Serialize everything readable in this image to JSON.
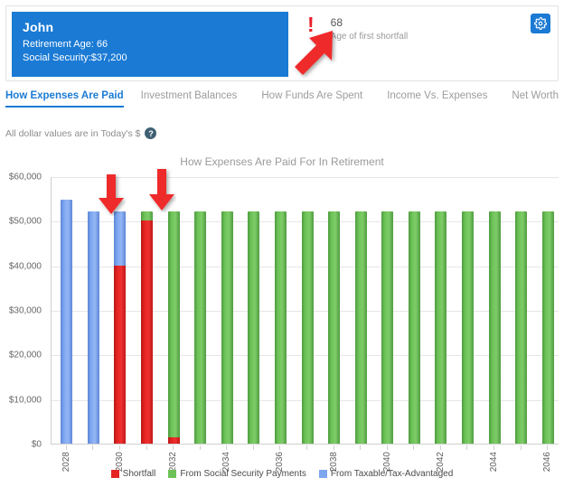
{
  "header": {
    "person": {
      "name": "John",
      "retirement_age_line": "Retirement Age: 66",
      "social_security_line": "Social Security:$37,200"
    },
    "metric": {
      "icon": "exclamation-icon",
      "value": "68",
      "label": "Age of first shortfall"
    },
    "settings_icon": "gear-icon"
  },
  "tabs": [
    {
      "label": "How Expenses Are Paid",
      "active": true
    },
    {
      "label": "Investment Balances",
      "active": false
    },
    {
      "label": "How Funds Are Spent",
      "active": false
    },
    {
      "label": "Income Vs. Expenses",
      "active": false
    },
    {
      "label": "Net Worth",
      "active": false
    }
  ],
  "subnote": {
    "text": "All dollar values are in Today's $",
    "help_icon": "question-mark-icon",
    "help_glyph": "?"
  },
  "colors": {
    "brand_blue": "#1a7ad4",
    "shortfall_red": "#e52222",
    "social_green": "#6cc257",
    "taxable_blue": "#7ea6ef",
    "annotation_red": "#ef2b2b"
  },
  "chart_data": {
    "type": "bar",
    "title": "How Expenses Are Paid For In Retirement",
    "xlabel": "",
    "ylabel": "",
    "ylim": [
      0,
      60000
    ],
    "ytick_labels": [
      "$0",
      "$10,000",
      "$20,000",
      "$30,000",
      "$40,000",
      "$50,000",
      "$60,000"
    ],
    "ytick_values": [
      0,
      10000,
      20000,
      30000,
      40000,
      50000,
      60000
    ],
    "grid": true,
    "stacked": true,
    "legend_position": "bottom",
    "categories": [
      "2028",
      "2029",
      "2030",
      "2031",
      "2032",
      "2033",
      "2034",
      "2035",
      "2036",
      "2037",
      "2038",
      "2039",
      "2040",
      "2041",
      "2042",
      "2043",
      "2044",
      "2045",
      "2046"
    ],
    "xtick_labels": [
      "2028",
      "2030",
      "2032",
      "2034",
      "2036",
      "2038",
      "2040",
      "2042",
      "2044",
      "2046"
    ],
    "series": [
      {
        "name": "Shortfall",
        "color": "#e52222",
        "values": [
          0,
          0,
          40000,
          50000,
          1500,
          0,
          0,
          0,
          0,
          0,
          0,
          0,
          0,
          0,
          0,
          0,
          0,
          0,
          0
        ]
      },
      {
        "name": "From Social Security Payments",
        "color": "#6cc257",
        "values": [
          0,
          0,
          0,
          2200,
          50500,
          52000,
          52000,
          52000,
          52000,
          52000,
          52000,
          52000,
          52000,
          52000,
          52000,
          52000,
          52000,
          52000,
          52000
        ]
      },
      {
        "name": "From Taxable/Tax-Advantaged",
        "color": "#7ea6ef",
        "values": [
          54700,
          52000,
          12000,
          0,
          0,
          0,
          0,
          0,
          0,
          0,
          0,
          0,
          0,
          0,
          0,
          0,
          0,
          0,
          0
        ]
      }
    ],
    "totals": [
      54700,
      52000,
      52000,
      52200,
      52000,
      52000,
      52000,
      52000,
      52000,
      52000,
      52000,
      52000,
      52000,
      52000,
      52000,
      52000,
      52000,
      52000,
      52000
    ]
  },
  "annotations": [
    {
      "name": "arrow-pointing-to-metric",
      "target": "age-of-first-shortfall"
    },
    {
      "name": "arrow-pointing-to-bar-2030",
      "target": "bar-2030"
    },
    {
      "name": "arrow-pointing-to-bar-2031",
      "target": "bar-2031"
    }
  ]
}
